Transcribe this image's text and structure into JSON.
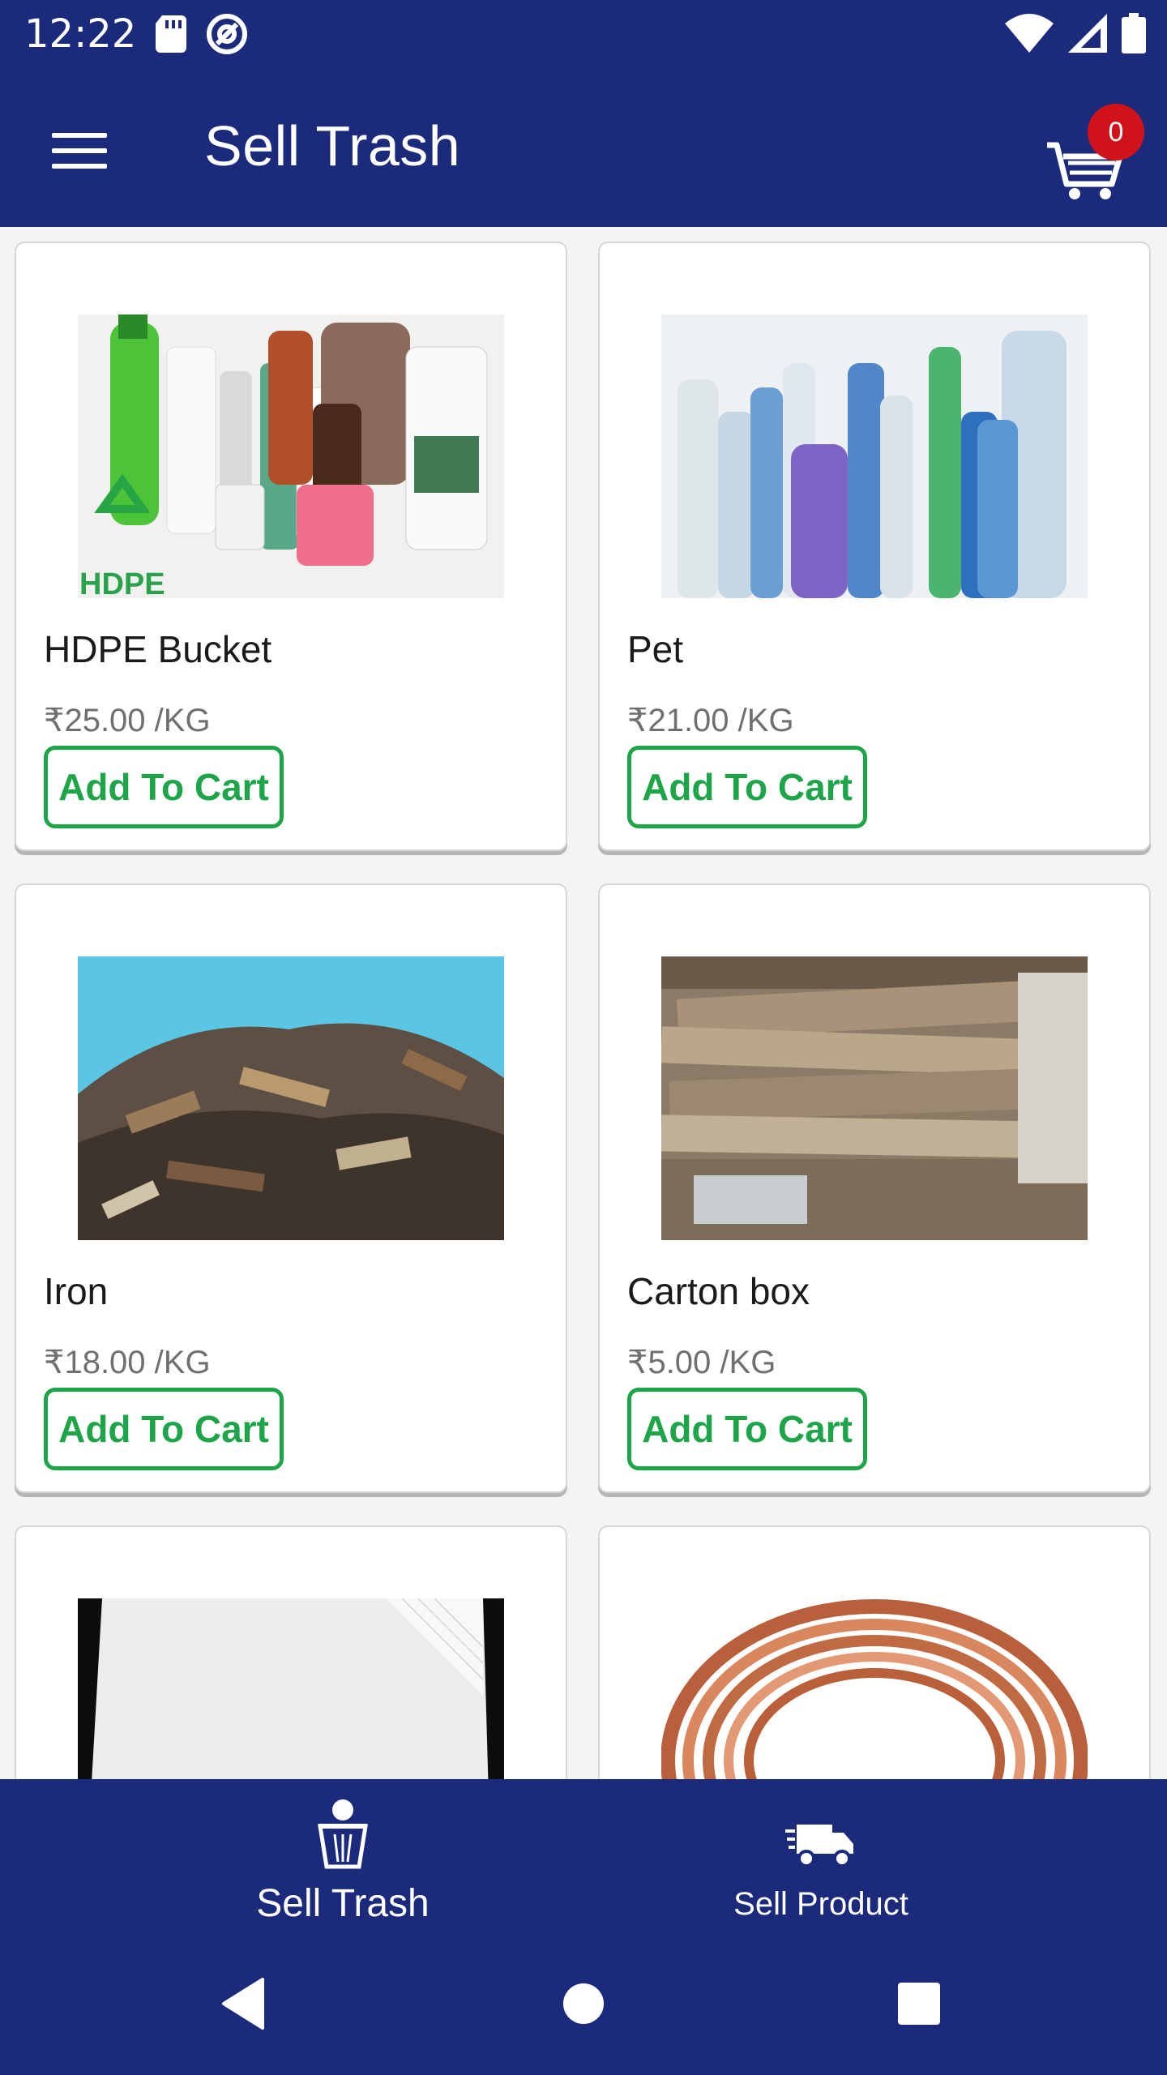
{
  "status_bar": {
    "time": "12:22",
    "icons": [
      "sd-card-icon",
      "at-sign-icon",
      "wifi-icon",
      "signal-icon",
      "battery-icon"
    ]
  },
  "app_bar": {
    "title": "Sell Trash",
    "cart_count": "0"
  },
  "products": [
    {
      "name": "HDPE Bucket",
      "price": "₹25.00 /KG",
      "button": "Add To Cart",
      "image": "hdpe-bottles-image"
    },
    {
      "name": "Pet",
      "price": "₹21.00 /KG",
      "button": "Add To Cart",
      "image": "pet-bottles-image"
    },
    {
      "name": "Iron",
      "price": "₹18.00 /KG",
      "button": "Add To Cart",
      "image": "scrap-iron-image"
    },
    {
      "name": "Carton box",
      "price": "₹5.00 /KG",
      "button": "Add To Cart",
      "image": "cardboard-image"
    },
    {
      "name": "",
      "price": "",
      "button": "",
      "image": "white-sheet-image"
    },
    {
      "name": "",
      "price": "",
      "button": "",
      "image": "copper-coil-image"
    }
  ],
  "bottom_nav": {
    "items": [
      {
        "label": "Sell Trash",
        "icon": "trash-bin-icon",
        "active": true
      },
      {
        "label": "Sell Product",
        "icon": "truck-icon",
        "active": false
      }
    ]
  },
  "colors": {
    "primary": "#1b2a7a",
    "accent_green": "#1ea54a",
    "badge_red": "#d0121b"
  }
}
